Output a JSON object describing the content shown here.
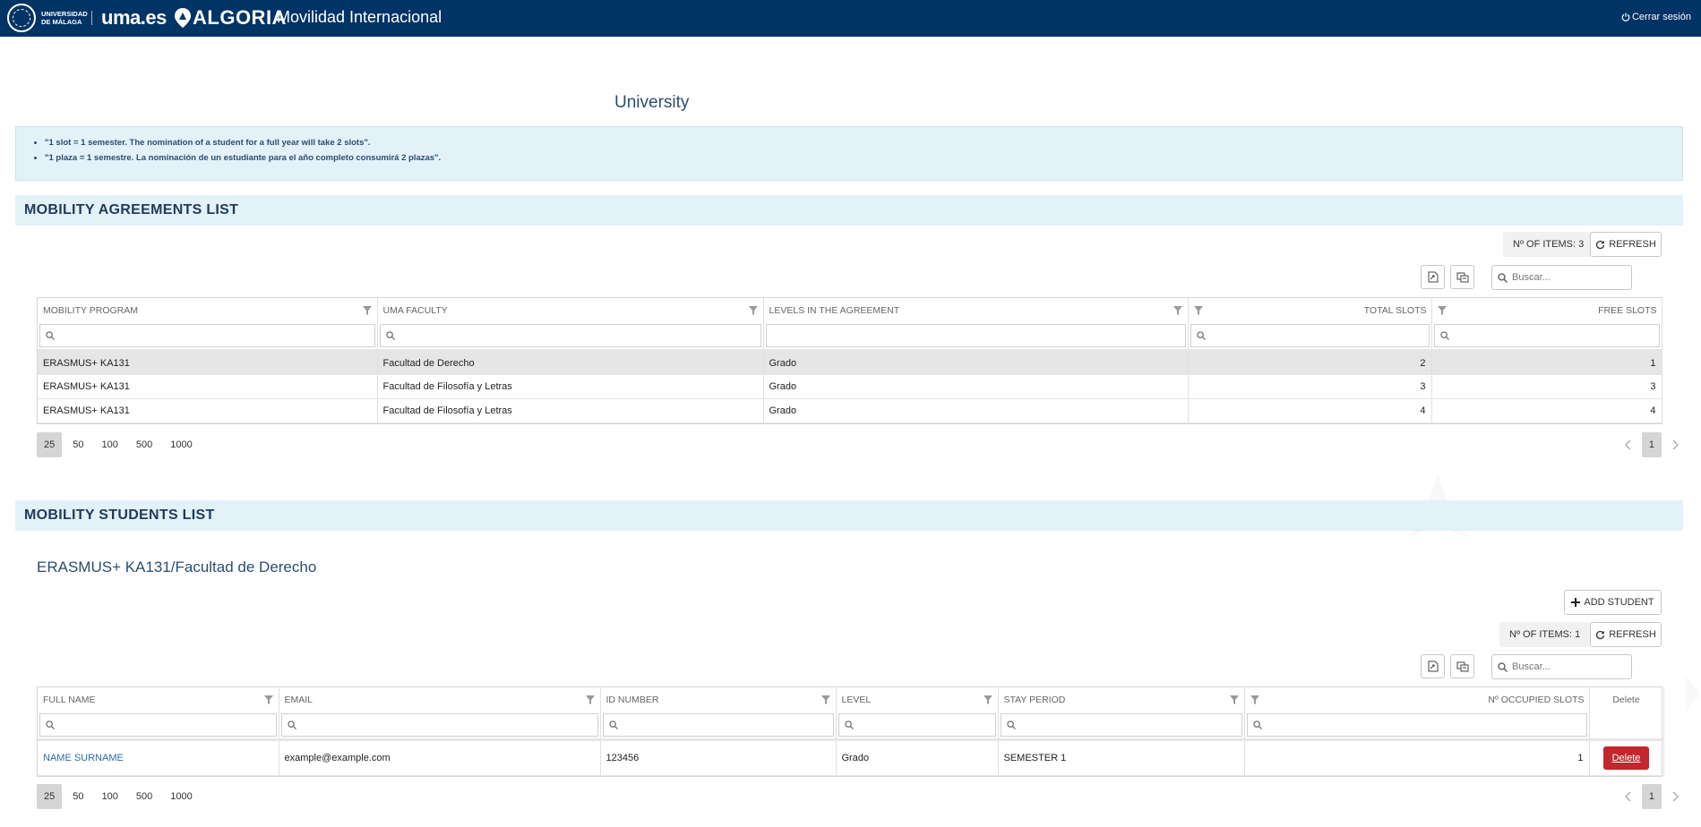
{
  "header": {
    "university_line1": "UNIVERSIDAD",
    "university_line2": "DE MÁLAGA",
    "uma_logo": "uma.es",
    "algoria": "ALGORIA",
    "app_title": "Movilidad Internacional",
    "logout_label": "Cerrar sesión",
    "logout_icon": "power-icon"
  },
  "page_title": "University",
  "info": {
    "lines": [
      "\"1 slot = 1 semester. The nomination of a student for a full year will take 2 slots\".",
      "\"1 plaza = 1 semestre. La nominación de un estudiante para el año completo consumirá 2 plazas\"."
    ]
  },
  "agreements": {
    "section_title": "MOBILITY AGREEMENTS LIST",
    "items_count": "Nº OF ITEMS: 3",
    "refresh_label": "REFRESH",
    "search_placeholder": "Buscar...",
    "columns": [
      "MOBILITY PROGRAM",
      "UMA FACULTY",
      "LEVELS IN THE AGREEMENT",
      "TOTAL SLOTS",
      "FREE SLOTS"
    ],
    "rows": [
      [
        "ERASMUS+ KA131",
        "Facultad de Derecho",
        "Grado",
        "2",
        "1"
      ],
      [
        "ERASMUS+ KA131",
        "Facultad de Filosofía y Letras",
        "Grado",
        "3",
        "3"
      ],
      [
        "ERASMUS+ KA131",
        "Facultad de Filosofía y Letras",
        "Grado",
        "4",
        "4"
      ]
    ],
    "page_sizes": [
      "25",
      "50",
      "100",
      "500",
      "1000"
    ],
    "current_page": "1"
  },
  "students": {
    "section_title": "MOBILITY STUDENTS LIST",
    "selected_agreement": "ERASMUS+ KA131/Facultad de Derecho",
    "add_student_label": "ADD STUDENT",
    "items_count": "Nº OF ITEMS: 1",
    "refresh_label": "REFRESH",
    "search_placeholder": "Buscar...",
    "columns": [
      "FULL NAME",
      "EMAIL",
      "ID NUMBER",
      "LEVEL",
      "STAY PERIOD",
      "Nº OCCUPIED SLOTS",
      "Delete"
    ],
    "rows": [
      [
        "NAME SURNAME",
        "example@example.com",
        "123456",
        "Grado",
        "SEMESTER 1",
        "1",
        "Delete"
      ]
    ],
    "page_sizes": [
      "25",
      "50",
      "100",
      "500",
      "1000"
    ],
    "current_page": "1"
  },
  "colors": {
    "header_bg": "#003366",
    "band_bg": "#e3f1f8",
    "title_text": "#1f3b5c",
    "delete_bg": "#c1272d",
    "link": "#2f6aa8"
  }
}
